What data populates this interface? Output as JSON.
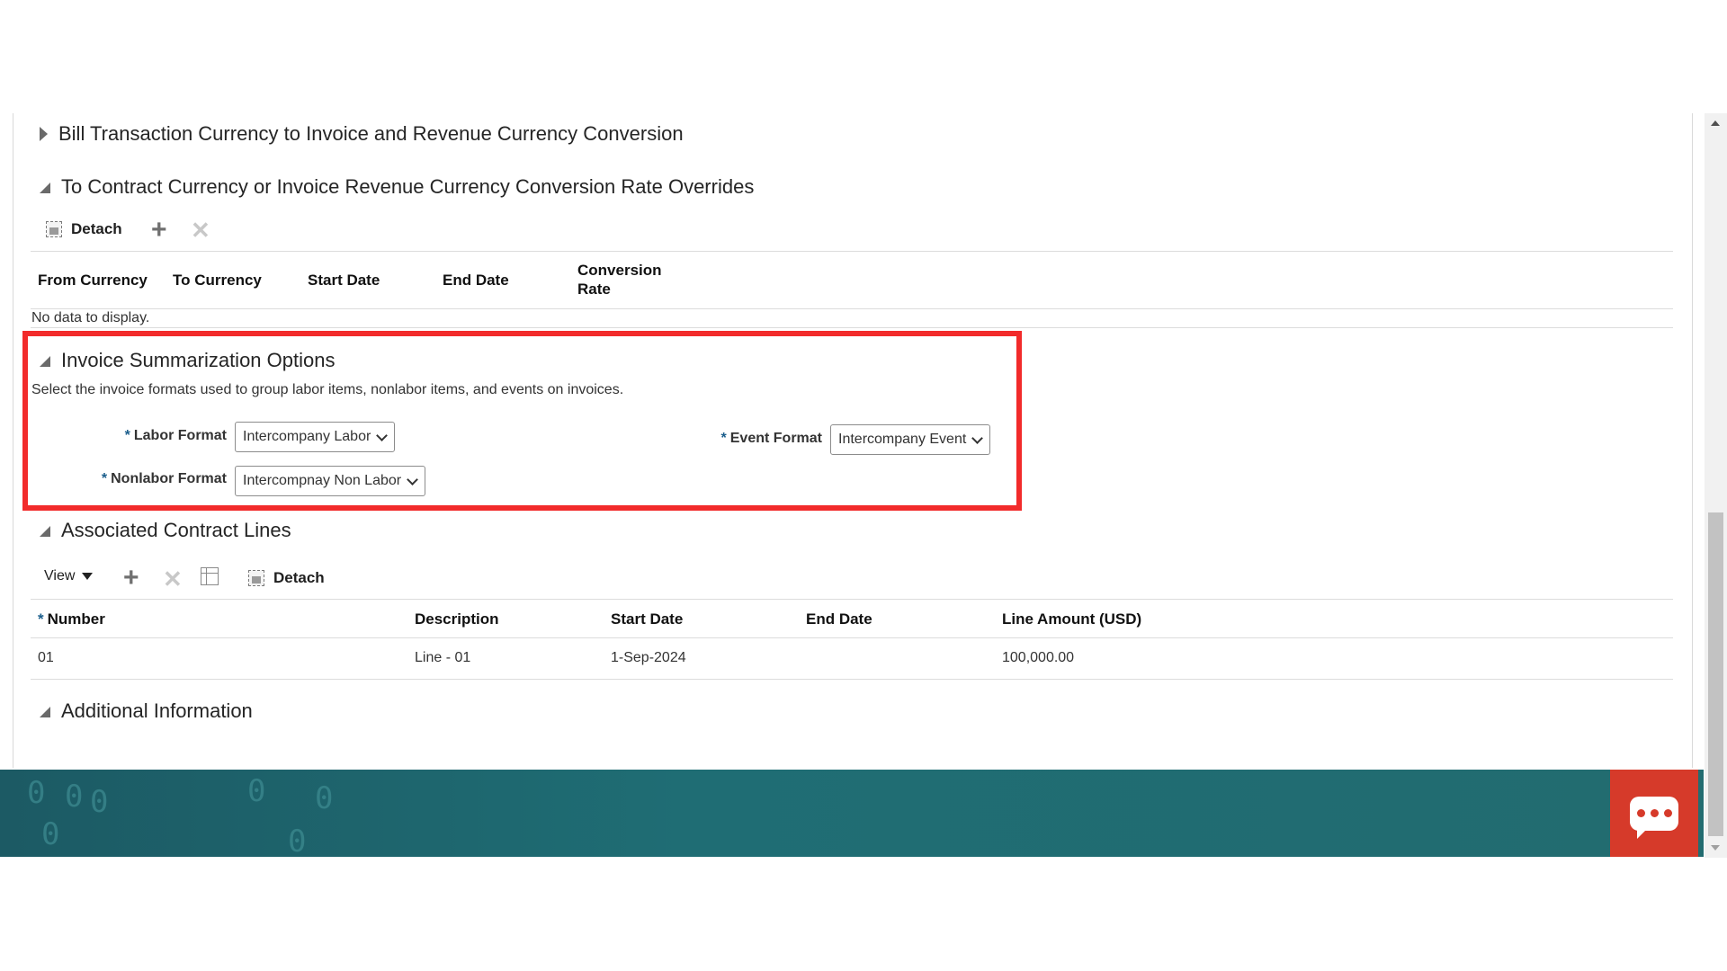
{
  "sections": {
    "bill_conversion": {
      "title": "Bill Transaction Currency to Invoice and Revenue Currency Conversion"
    },
    "rate_overrides": {
      "title": "To Contract Currency or Invoice Revenue Currency Conversion Rate Overrides",
      "toolbar": {
        "detach_label": "Detach"
      },
      "columns": [
        "From Currency",
        "To Currency",
        "Start Date",
        "End Date",
        "Conversion Rate"
      ],
      "conversion_rate_line1": "Conversion",
      "conversion_rate_line2": "Rate",
      "empty_text": "No data to display."
    },
    "invoice_summarization": {
      "title": "Invoice Summarization Options",
      "description": "Select the invoice formats used to group labor items, nonlabor items, and events on invoices.",
      "required_marker": "*",
      "labor_format_label": "Labor Format",
      "labor_format_value": "Intercompany Labor",
      "nonlabor_format_label": "Nonlabor Format",
      "nonlabor_format_value": "Intercompnay Non Labor",
      "event_format_label": "Event Format",
      "event_format_value": "Intercompany Event"
    },
    "associated_lines": {
      "title": "Associated Contract Lines",
      "toolbar": {
        "view_label": "View",
        "detach_label": "Detach"
      },
      "columns": {
        "number": "Number",
        "description": "Description",
        "start_date": "Start Date",
        "end_date": "End Date",
        "line_amount": "Line Amount (USD)"
      },
      "rows": [
        {
          "number": "01",
          "description": "Line - 01",
          "start_date": "1-Sep-2024",
          "end_date": "",
          "line_amount": "100,000.00"
        }
      ]
    },
    "additional_info": {
      "title": "Additional Information"
    }
  },
  "colors": {
    "highlight": "#f22b2b",
    "footer": "#1f6d74",
    "chat_button": "#d63a2a"
  },
  "icons": [
    "expand-right-icon",
    "collapse-down-icon",
    "detach-icon",
    "add-icon",
    "delete-icon",
    "freeze-icon",
    "chat-icon"
  ]
}
